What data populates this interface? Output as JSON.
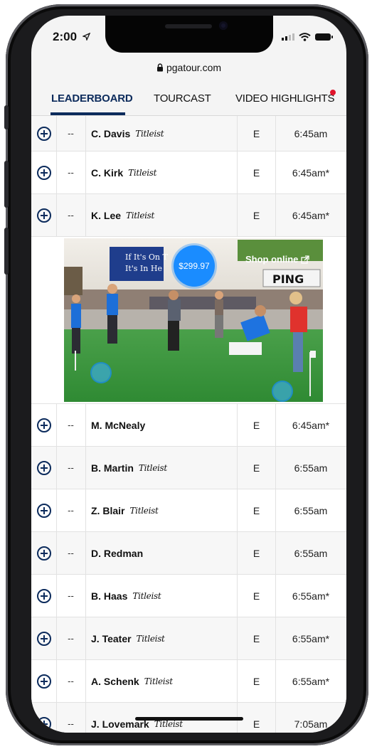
{
  "status": {
    "time": "2:00"
  },
  "browser": {
    "url": "pgatour.com"
  },
  "tabs": [
    {
      "label": "LEADERBOARD",
      "active": true
    },
    {
      "label": "TOURCAST"
    },
    {
      "label": "VIDEO HIGHLIGHTS",
      "badge": true
    }
  ],
  "rows": [
    {
      "pos": "--",
      "name": "C. Davis",
      "brand": "Titleist",
      "total": "E",
      "time": "6:45am"
    },
    {
      "pos": "--",
      "name": "C. Kirk",
      "brand": "Titleist",
      "total": "E",
      "time": "6:45am*"
    },
    {
      "pos": "--",
      "name": "K. Lee",
      "brand": "Titleist",
      "total": "E",
      "time": "6:45am*"
    },
    {
      "pos": "--",
      "name": "M. McNealy",
      "brand": "",
      "total": "E",
      "time": "6:45am*"
    },
    {
      "pos": "--",
      "name": "B. Martin",
      "brand": "Titleist",
      "total": "E",
      "time": "6:55am"
    },
    {
      "pos": "--",
      "name": "Z. Blair",
      "brand": "Titleist",
      "total": "E",
      "time": "6:55am"
    },
    {
      "pos": "--",
      "name": "D. Redman",
      "brand": "",
      "total": "E",
      "time": "6:55am"
    },
    {
      "pos": "--",
      "name": "B. Haas",
      "brand": "Titleist",
      "total": "E",
      "time": "6:55am*"
    },
    {
      "pos": "--",
      "name": "J. Teater",
      "brand": "Titleist",
      "total": "E",
      "time": "6:55am*"
    },
    {
      "pos": "--",
      "name": "A. Schenk",
      "brand": "Titleist",
      "total": "E",
      "time": "6:55am*"
    },
    {
      "pos": "--",
      "name": "J. Lovemark",
      "brand": "Titleist",
      "total": "E",
      "time": "7:05am"
    }
  ],
  "ad": {
    "price": "$299.97",
    "shop_label": "Shop online",
    "sign_line1": "If It's On T",
    "sign_line2": "It's In He",
    "logo_text": "PING"
  },
  "colors": {
    "navy": "#0c2b5c",
    "badge": "#e0142b",
    "price_bubble": "#1a8cff"
  }
}
